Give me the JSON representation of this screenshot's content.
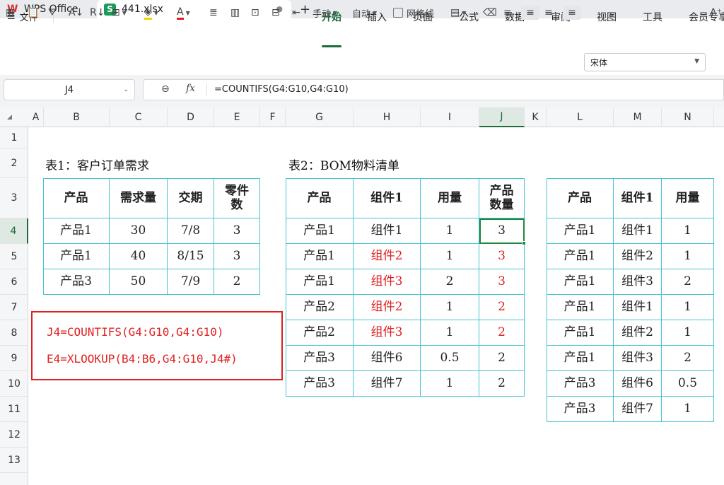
{
  "tabs": {
    "app_name": "WPS Office",
    "file_name": "441.xlsx",
    "new_tab": "+"
  },
  "menu": {
    "file": "文件",
    "items": [
      "开始",
      "插入",
      "页面",
      "公式",
      "数据",
      "审阅",
      "视图",
      "工具",
      "会员专享"
    ],
    "active": "开始"
  },
  "toolbar": {
    "manual": "手动",
    "auto": "自动",
    "gridlines": "网格线",
    "font": "宋体"
  },
  "formula_bar": {
    "cell_ref": "J4",
    "fx": "fx",
    "formula": "=COUNTIFS(G4:G10,G4:G10)"
  },
  "columns": [
    "A",
    "B",
    "C",
    "D",
    "E",
    "F",
    "G",
    "H",
    "I",
    "J",
    "K",
    "L",
    "M",
    "N"
  ],
  "rows": [
    "1",
    "2",
    "3",
    "4",
    "5",
    "6",
    "7",
    "8",
    "9",
    "10",
    "11",
    "12",
    "13"
  ],
  "selected_column": "J",
  "selected_row": "4",
  "table1": {
    "caption": "表1：客户订单需求",
    "headers": [
      "产品",
      "需求量",
      "交期",
      "零件数"
    ],
    "rows": [
      [
        "产品1",
        "30",
        "7/8",
        "3"
      ],
      [
        "产品1",
        "40",
        "8/15",
        "3"
      ],
      [
        "产品3",
        "50",
        "7/9",
        "2"
      ]
    ]
  },
  "table2": {
    "caption": "表2：BOM物料清单",
    "headers": [
      "产品",
      "组件1",
      "用量",
      "产品数量"
    ],
    "rows": [
      [
        "产品1",
        "组件1",
        "1",
        "3"
      ],
      [
        "产品1",
        "组件2",
        "1",
        "3"
      ],
      [
        "产品1",
        "组件3",
        "2",
        "3"
      ],
      [
        "产品2",
        "组件2",
        "1",
        "2"
      ],
      [
        "产品2",
        "组件3",
        "1",
        "2"
      ],
      [
        "产品3",
        "组件6",
        "0.5",
        "2"
      ],
      [
        "产品3",
        "组件7",
        "1",
        "2"
      ]
    ]
  },
  "table3": {
    "headers": [
      "产品",
      "组件1",
      "用量"
    ],
    "rows": [
      [
        "产品1",
        "组件1",
        "1"
      ],
      [
        "产品1",
        "组件2",
        "1"
      ],
      [
        "产品1",
        "组件3",
        "2"
      ],
      [
        "产品1",
        "组件1",
        "1"
      ],
      [
        "产品1",
        "组件2",
        "1"
      ],
      [
        "产品1",
        "组件3",
        "2"
      ],
      [
        "产品3",
        "组件6",
        "0.5"
      ],
      [
        "产品3",
        "组件7",
        "1"
      ]
    ]
  },
  "note": {
    "line1": "J4=COUNTIFS(G4:G10,G4:G10)",
    "line2": "E4=XLOOKUP(B4:B6,G4:G10,J4#)"
  },
  "colors": {
    "accent": "#1e6b3a",
    "highlight_red": "#e02020",
    "table_border": "#45c3d2"
  }
}
